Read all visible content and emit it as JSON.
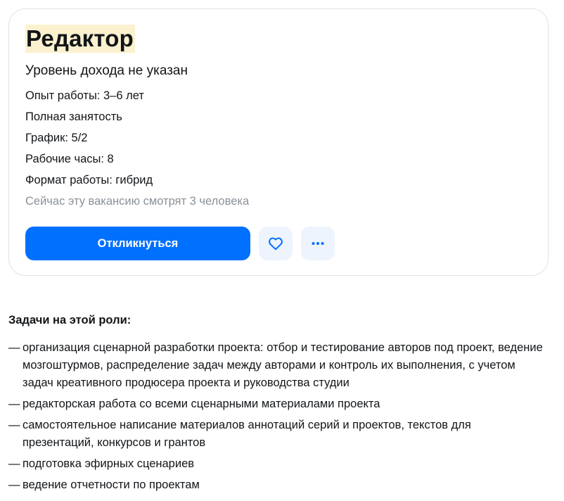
{
  "vacancy": {
    "title": "Редактор",
    "salary": "Уровень дохода не указан",
    "experience": "Опыт работы: 3–6 лет",
    "employment": "Полная занятость",
    "schedule": "График: 5/2",
    "hours": "Рабочие часы: 8",
    "work_format": "Формат работы: гибрид",
    "watchers": "Сейчас эту вакансию смотрят 3 человека"
  },
  "actions": {
    "apply_label": "Откликнуться",
    "favorite_icon": "heart-icon",
    "more_icon": "more-dots-icon"
  },
  "colors": {
    "accent": "#0070ff",
    "title_highlight": "#fcf1cf",
    "icon_button_bg": "#eef4fd",
    "muted_text": "#8a9199"
  },
  "tasks": {
    "heading": "Задачи на этой роли:",
    "bullet": "—",
    "items": [
      "организация сценарной разработки проекта: отбор и тестирование авторов под проект, ведение мозгоштурмов, распределение задач между авторами и контроль их выполнения, с учетом задач креативного продюсера проекта и руководства студии",
      "редакторская работа со всеми сценарными материалами проекта",
      "самостоятельное написание материалов аннотаций серий и проектов, текстов для презентаций, конкурсов и грантов",
      "подготовка эфирных сценариев",
      "ведение отчетности по проектам"
    ]
  }
}
